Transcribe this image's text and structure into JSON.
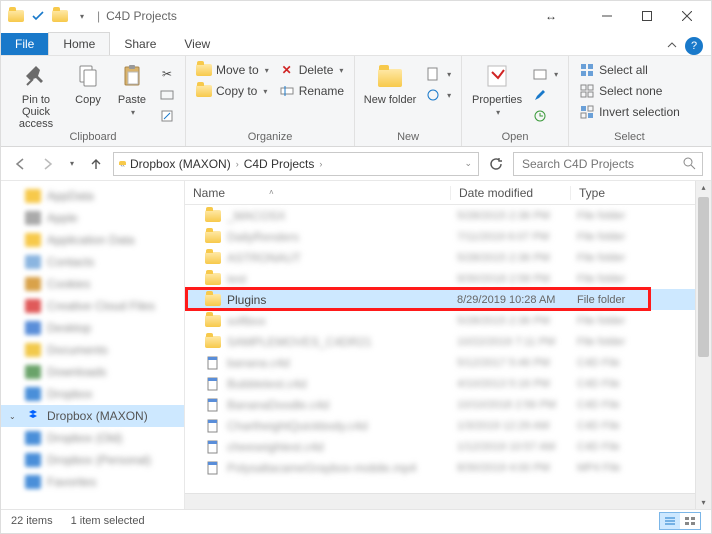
{
  "window": {
    "title": "C4D Projects"
  },
  "tabs": {
    "file": "File",
    "home": "Home",
    "share": "Share",
    "view": "View"
  },
  "ribbon": {
    "clipboard": {
      "label": "Clipboard",
      "pin": "Pin to Quick access",
      "copy": "Copy",
      "paste": "Paste"
    },
    "organize": {
      "label": "Organize",
      "moveto": "Move to",
      "copyto": "Copy to",
      "delete": "Delete",
      "rename": "Rename"
    },
    "new": {
      "label": "New",
      "newfolder": "New folder"
    },
    "open": {
      "label": "Open",
      "properties": "Properties"
    },
    "select": {
      "label": "Select",
      "selectall": "Select all",
      "selectnone": "Select none",
      "invert": "Invert selection"
    }
  },
  "breadcrumb": {
    "seg1": "Dropbox (MAXON)",
    "seg2": "C4D Projects"
  },
  "search": {
    "placeholder": "Search C4D Projects"
  },
  "columns": {
    "name": "Name",
    "date": "Date modified",
    "type": "Type"
  },
  "files": [
    {
      "name": "_MACOSX",
      "date": "5/28/2015 2:36 PM",
      "type": "File folder",
      "icon": "folder"
    },
    {
      "name": "DailyRenders",
      "date": "7/11/2019 6:07 PM",
      "type": "File folder",
      "icon": "folder"
    },
    {
      "name": "ASTRONAUT",
      "date": "5/28/2015 2:36 PM",
      "type": "File folder",
      "icon": "folder"
    },
    {
      "name": "test",
      "date": "9/30/2018 2:58 PM",
      "type": "File folder",
      "icon": "folder"
    },
    {
      "name": "Plugins",
      "date": "8/29/2019 10:28 AM",
      "type": "File folder",
      "icon": "folder",
      "selected": true
    },
    {
      "name": "softbox",
      "date": "5/28/2015 2:36 PM",
      "type": "File folder",
      "icon": "folder"
    },
    {
      "name": "SAMPLEMOVES_C4DR21",
      "date": "10/22/2019 7:11 PM",
      "type": "File folder",
      "icon": "folder"
    },
    {
      "name": "banana.c4d",
      "date": "5/12/2017 5:46 PM",
      "type": "C4D File",
      "icon": "file"
    },
    {
      "name": "Bubbletest.c4d",
      "date": "4/10/2013 5:16 PM",
      "type": "C4D File",
      "icon": "file"
    },
    {
      "name": "BananaDoodle.c4d",
      "date": "10/10/2018 2:56 PM",
      "type": "C4D File",
      "icon": "file"
    },
    {
      "name": "ChartheightQuickbody.c4d",
      "date": "1/3/2019 12:29 AM",
      "type": "C4D File",
      "icon": "file"
    },
    {
      "name": "cheeseightest.c4d",
      "date": "1/12/2019 10:57 AM",
      "type": "C4D File",
      "icon": "file"
    },
    {
      "name": "PolysaltacameGraybox-mobile.mp4",
      "date": "8/30/2019 4:00 PM",
      "type": "MP4 File",
      "icon": "file"
    }
  ],
  "nav": {
    "items": [
      "AppData",
      "Apple",
      "Application Data",
      "Contacts",
      "Cookies",
      "Creative Cloud Files",
      "Desktop",
      "Documents",
      "Downloads",
      "Dropbox"
    ],
    "selected": "Dropbox (MAXON)",
    "after": [
      "Dropbox (Old)",
      "Dropbox (Personal)",
      "Favorites"
    ]
  },
  "status": {
    "count": "22 items",
    "selected": "1 item selected"
  }
}
